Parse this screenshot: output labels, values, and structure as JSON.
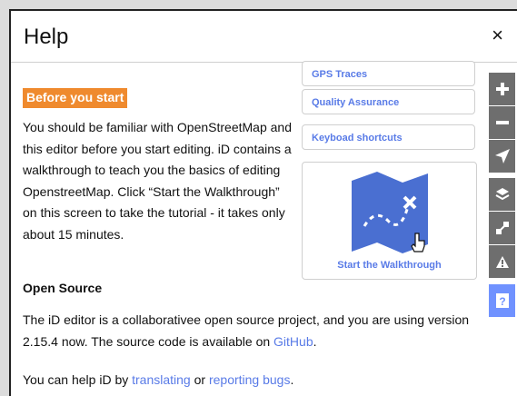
{
  "panel": {
    "title": "Help",
    "close_label": "×"
  },
  "section_before": {
    "heading": "Before you start",
    "text": "You should be familiar with OpenStreetMap and this editor before you start editing. iD contains a walkthrough to teach you the basics of editing OpenstreetMap. Click “Start the Walkthrough” on this screen to take the tutorial - it takes only about 15 minutes."
  },
  "doc_links": [
    {
      "label": "GPS Traces"
    },
    {
      "label": "Quality Assurance"
    },
    {
      "label": "Keyboad shortcuts"
    }
  ],
  "walkthrough": {
    "label": "Start the Walkthrough",
    "icon": "map-walkthrough-icon"
  },
  "section_open_source": {
    "heading": "Open Source",
    "p1_before": "The iD editor is a collaborativee open source project, and you  are using version 2.15.4 now. The source code is available on ",
    "p1_link": "GitHub",
    "p1_after": ".",
    "p2_before": "You can help iD by ",
    "p2_link1": "translating",
    "p2_mid": " or ",
    "p2_link2": "reporting bugs",
    "p2_after": "."
  },
  "map_controls": [
    {
      "icon": "zoom-in-icon"
    },
    {
      "icon": "zoom-out-icon"
    },
    {
      "icon": "geolocate-icon"
    },
    {
      "icon": "layers-icon"
    },
    {
      "icon": "map-data-icon"
    },
    {
      "icon": "issues-icon"
    },
    {
      "icon": "help-icon"
    }
  ],
  "colors": {
    "accent": "#597be7",
    "heading_badge": "#ef8a2e",
    "controls": "#6e6e6e",
    "help_active": "#7092ff"
  }
}
